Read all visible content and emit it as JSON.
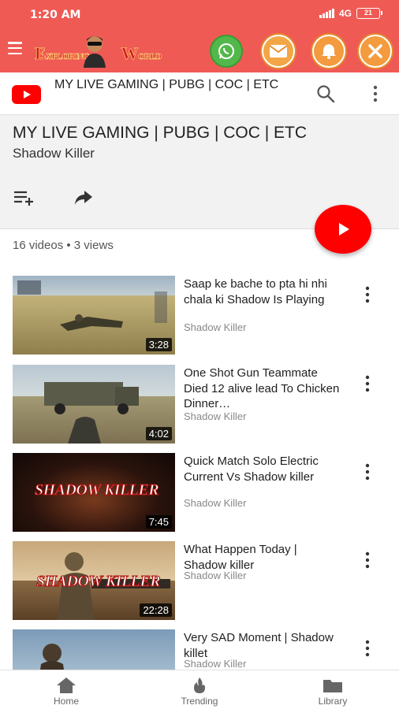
{
  "status_bar": {
    "time": "1:20 AM",
    "network": "4G",
    "battery": "21"
  },
  "app_header": {
    "logo_text": "EXPLORING WORLD"
  },
  "toolbar": {
    "title": "MY LIVE GAMING | PUBG | COC | ETC"
  },
  "playlist": {
    "title": "MY LIVE GAMING | PUBG | COC | ETC",
    "owner": "Shadow Killer",
    "stats": "16 videos • 3 views"
  },
  "videos": [
    {
      "title": "Saap ke bache to pta hi nhi chala ki Shadow Is Playing",
      "channel": "Shadow Killer",
      "duration": "3:28"
    },
    {
      "title": "One Shot Gun Teammate Died 12 alive lead To Chicken Dinner…",
      "channel": "Shadow Killer",
      "duration": "4:02"
    },
    {
      "title": "Quick Match Solo Electric Current Vs Shadow killer",
      "channel": "Shadow Killer",
      "duration": "7:45"
    },
    {
      "title": "What Happen Today | Shadow killer",
      "channel": "Shadow Killer",
      "duration": "22:28"
    },
    {
      "title": "Very SAD Moment | Shadow killet",
      "channel": "Shadow Killer",
      "duration": ""
    }
  ],
  "thumbnail_brand": "SHADOW KILLER",
  "bottom_nav": [
    {
      "label": "Home",
      "icon": "home-icon"
    },
    {
      "label": "Trending",
      "icon": "trending-flame-icon"
    },
    {
      "label": "Library",
      "icon": "folder-icon"
    }
  ],
  "colors": {
    "app_red": "#ef5a55",
    "youtube_red": "#ff0000"
  }
}
